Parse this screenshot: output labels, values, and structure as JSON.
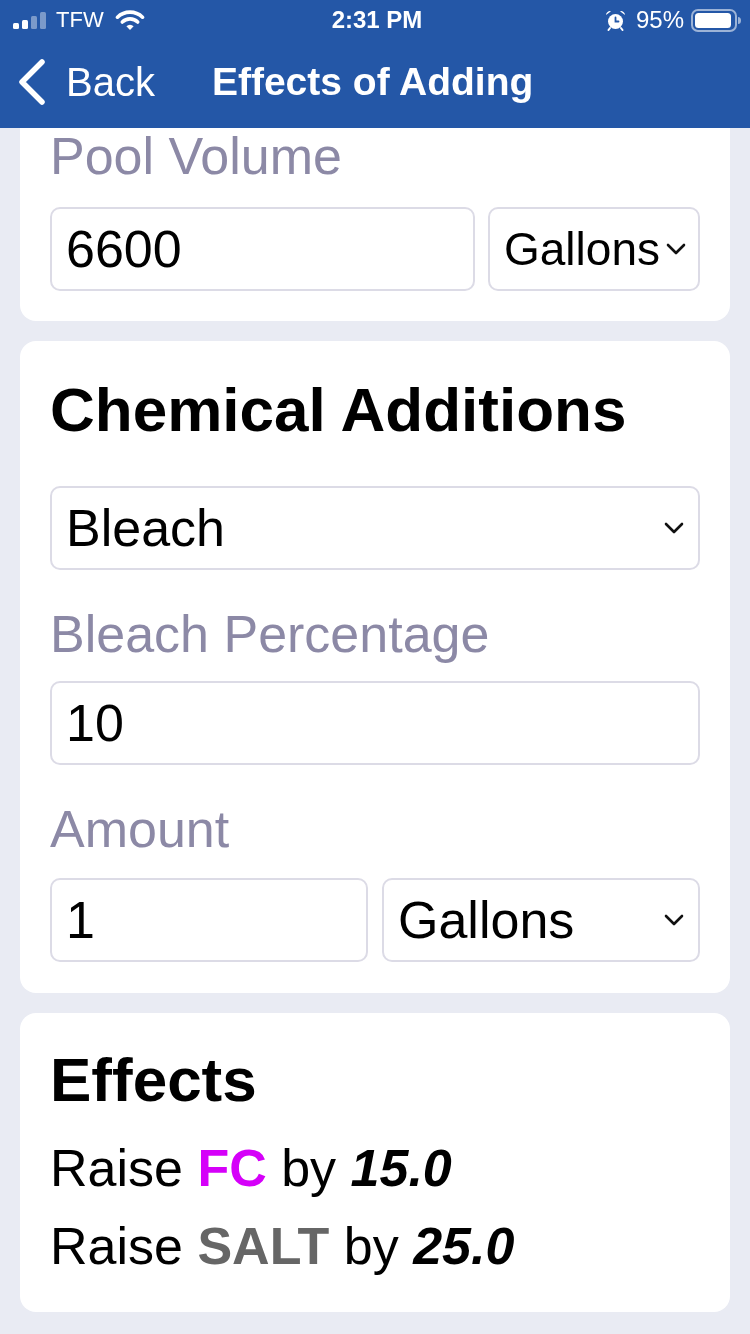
{
  "status_bar": {
    "carrier": "TFW",
    "time": "2:31 PM",
    "battery": "95%"
  },
  "nav_bar": {
    "back": "Back",
    "title": "Effects of Adding"
  },
  "pool_volume": {
    "label": "Pool Volume",
    "value": "6600",
    "unit": "Gallons"
  },
  "chemical_additions": {
    "title": "Chemical Additions",
    "chemical": "Bleach",
    "percentage_label": "Bleach Percentage",
    "percentage": "10",
    "amount_label": "Amount",
    "amount": "1",
    "amount_unit": "Gallons"
  },
  "effects": {
    "title": "Effects",
    "items": [
      {
        "verb": "Raise",
        "chemical": "FC",
        "color": "#d500f9",
        "connector": "by",
        "amount": "15.0"
      },
      {
        "verb": "Raise",
        "chemical": "SALT",
        "color": "#666666",
        "connector": "by",
        "amount": "25.0"
      }
    ]
  }
}
